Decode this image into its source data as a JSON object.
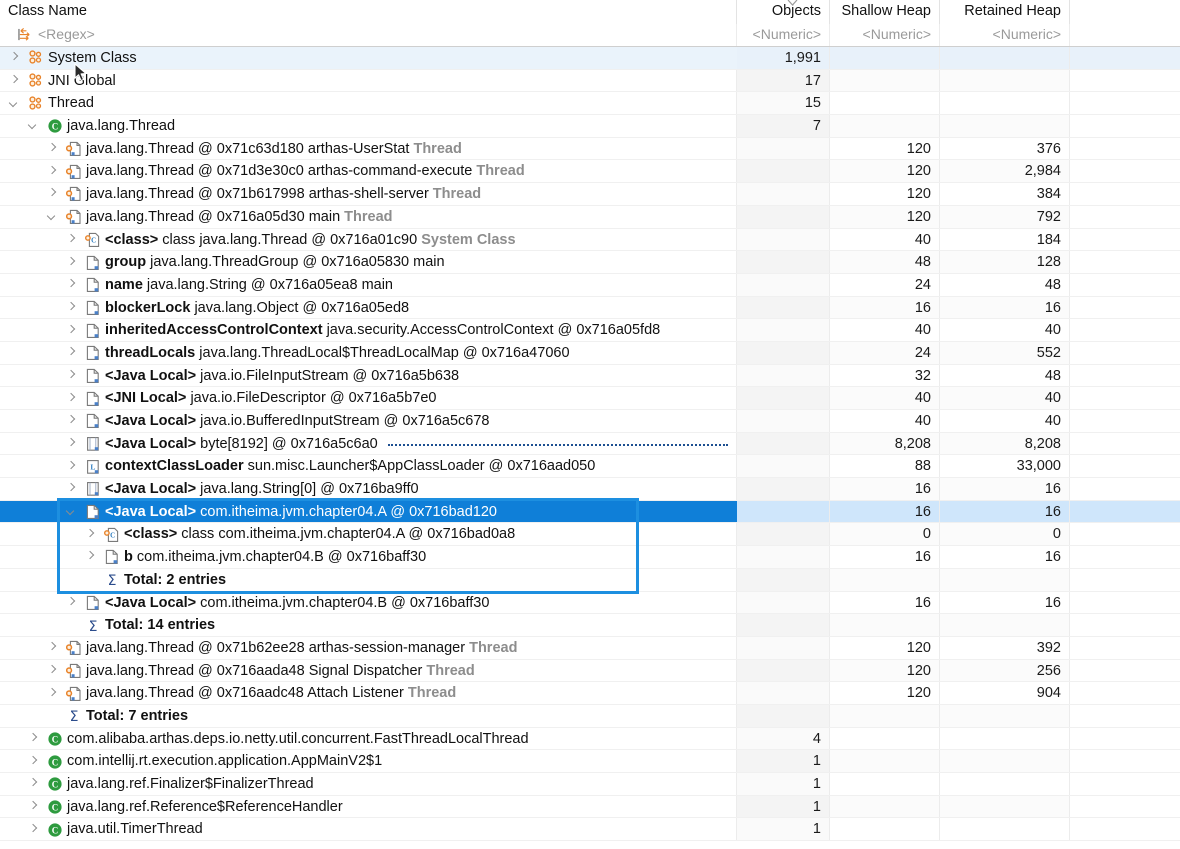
{
  "header": {
    "columns": [
      {
        "key": "name",
        "label": "Class Name",
        "filter": "<Regex>",
        "align": "left"
      },
      {
        "key": "objects",
        "label": "Objects",
        "filter": "<Numeric>",
        "align": "right"
      },
      {
        "key": "shallow",
        "label": "Shallow Heap",
        "filter": "<Numeric>",
        "align": "right"
      },
      {
        "key": "retained",
        "label": "Retained Heap",
        "filter": "<Numeric>",
        "align": "right"
      }
    ],
    "sorted_column": "Objects"
  },
  "colors": {
    "selection_bg": "#0f7fd8",
    "selection_row_tint": "#cfe6fb",
    "annotation_box": "#1d8fe0",
    "hover_row": "#eaf3fb",
    "class_icon": "#2e9b3f",
    "gcroot_icon": "#e8832a",
    "dim_text": "#8d8d8d"
  },
  "annotation": {
    "type": "rectangle-highlight",
    "around": "java-local-A-subtree"
  },
  "rows": [
    {
      "id": "system-class",
      "indent": 0,
      "arrow": "right",
      "icon": "gcroot-group",
      "name": "System Class",
      "objects": "1,991",
      "shallow": "",
      "retained": "",
      "state": "hover"
    },
    {
      "id": "jni-global",
      "indent": 0,
      "arrow": "right",
      "icon": "gcroot-group",
      "name": "JNI Global",
      "objects": "17",
      "shallow": "",
      "retained": ""
    },
    {
      "id": "thread-group",
      "indent": 0,
      "arrow": "down",
      "icon": "gcroot-group",
      "name": "Thread",
      "objects": "15",
      "shallow": "",
      "retained": ""
    },
    {
      "id": "java-lang-thread-class",
      "indent": 1,
      "arrow": "down",
      "icon": "class",
      "name": "java.lang.Thread",
      "objects": "7",
      "shallow": "",
      "retained": ""
    },
    {
      "id": "t-userstat",
      "indent": 2,
      "arrow": "right",
      "icon": "instance-gcroot",
      "prefix": "",
      "name": "java.lang.Thread @ 0x71c63d180  arthas-UserStat",
      "suffix": "Thread",
      "objects": "",
      "shallow": "120",
      "retained": "376"
    },
    {
      "id": "t-command-execute",
      "indent": 2,
      "arrow": "right",
      "icon": "instance-gcroot",
      "name": "java.lang.Thread @ 0x71d3e30c0  arthas-command-execute",
      "suffix": "Thread",
      "objects": "",
      "shallow": "120",
      "retained": "2,984"
    },
    {
      "id": "t-shell-server",
      "indent": 2,
      "arrow": "right",
      "icon": "instance-gcroot",
      "name": "java.lang.Thread @ 0x71b617998  arthas-shell-server",
      "suffix": "Thread",
      "objects": "",
      "shallow": "120",
      "retained": "384"
    },
    {
      "id": "t-main",
      "indent": 2,
      "arrow": "down",
      "icon": "instance-gcroot",
      "name": "java.lang.Thread @ 0x716a05d30  main",
      "suffix": "Thread",
      "objects": "",
      "shallow": "120",
      "retained": "792"
    },
    {
      "id": "f-class",
      "indent": 3,
      "arrow": "right",
      "icon": "class-field",
      "bold": "<class>",
      "name": "class java.lang.Thread @ 0x716a01c90",
      "suffix": "System Class",
      "objects": "",
      "shallow": "40",
      "retained": "184"
    },
    {
      "id": "f-group",
      "indent": 3,
      "arrow": "right",
      "icon": "field",
      "bold": "group",
      "name": "java.lang.ThreadGroup @ 0x716a05830  main",
      "objects": "",
      "shallow": "48",
      "retained": "128"
    },
    {
      "id": "f-name",
      "indent": 3,
      "arrow": "right",
      "icon": "field",
      "bold": "name",
      "name": "java.lang.String @ 0x716a05ea8  main",
      "objects": "",
      "shallow": "24",
      "retained": "48"
    },
    {
      "id": "f-blockerlock",
      "indent": 3,
      "arrow": "right",
      "icon": "field",
      "bold": "blockerLock",
      "name": "java.lang.Object @ 0x716a05ed8",
      "objects": "",
      "shallow": "16",
      "retained": "16"
    },
    {
      "id": "f-inherited-acc",
      "indent": 3,
      "arrow": "right",
      "icon": "field",
      "bold": "inheritedAccessControlContext",
      "name": "java.security.AccessControlContext @ 0x716a05fd8",
      "objects": "",
      "shallow": "40",
      "retained": "40"
    },
    {
      "id": "f-threadlocals",
      "indent": 3,
      "arrow": "right",
      "icon": "field",
      "bold": "threadLocals",
      "name": "java.lang.ThreadLocal$ThreadLocalMap @ 0x716a47060",
      "objects": "",
      "shallow": "24",
      "retained": "552"
    },
    {
      "id": "f-jl-fileinputstream",
      "indent": 3,
      "arrow": "right",
      "icon": "field",
      "bold": "<Java Local>",
      "name": "java.io.FileInputStream @ 0x716a5b638",
      "objects": "",
      "shallow": "32",
      "retained": "48"
    },
    {
      "id": "f-jni-filedescriptor",
      "indent": 3,
      "arrow": "right",
      "icon": "field",
      "bold": "<JNI Local>",
      "name": "java.io.FileDescriptor @ 0x716a5b7e0",
      "objects": "",
      "shallow": "40",
      "retained": "40"
    },
    {
      "id": "f-jl-bufferedinputstream",
      "indent": 3,
      "arrow": "right",
      "icon": "field",
      "bold": "<Java Local>",
      "name": "java.io.BufferedInputStream @ 0x716a5c678",
      "objects": "",
      "shallow": "40",
      "retained": "40"
    },
    {
      "id": "f-jl-byte8192",
      "indent": 3,
      "arrow": "right",
      "icon": "array",
      "bold": "<Java Local>",
      "name": "byte[8192] @ 0x716a5c6a0",
      "dots": true,
      "objects": "",
      "shallow": "8,208",
      "retained": "8,208"
    },
    {
      "id": "f-contextclassloader",
      "indent": 3,
      "arrow": "right",
      "icon": "classloader",
      "bold": "contextClassLoader",
      "name": "sun.misc.Launcher$AppClassLoader @ 0x716aad050",
      "objects": "",
      "shallow": "88",
      "retained": "33,000"
    },
    {
      "id": "f-jl-string0",
      "indent": 3,
      "arrow": "right",
      "icon": "array",
      "bold": "<Java Local>",
      "name": "java.lang.String[0] @ 0x716ba9ff0",
      "objects": "",
      "shallow": "16",
      "retained": "16"
    },
    {
      "id": "f-jl-A",
      "indent": 3,
      "arrow": "down",
      "icon": "field",
      "bold": "<Java Local>",
      "name": "com.itheima.jvm.chapter04.A @ 0x716bad120",
      "objects": "",
      "shallow": "16",
      "retained": "16",
      "state": "selected"
    },
    {
      "id": "f-A-class",
      "indent": 4,
      "arrow": "right",
      "icon": "class-field",
      "bold": "<class>",
      "name": "class com.itheima.jvm.chapter04.A @ 0x716bad0a8",
      "objects": "",
      "shallow": "0",
      "retained": "0"
    },
    {
      "id": "f-A-b",
      "indent": 4,
      "arrow": "right",
      "icon": "field",
      "bold": "b",
      "name": "com.itheima.jvm.chapter04.B @ 0x716baff30",
      "objects": "",
      "shallow": "16",
      "retained": "16"
    },
    {
      "id": "total-2",
      "indent": 4,
      "arrow": "none",
      "icon": "sum",
      "total": "Total: 2 entries",
      "objects": "",
      "shallow": "",
      "retained": ""
    },
    {
      "id": "f-jl-B",
      "indent": 3,
      "arrow": "right",
      "icon": "field",
      "bold": "<Java Local>",
      "name": "com.itheima.jvm.chapter04.B @ 0x716baff30",
      "objects": "",
      "shallow": "16",
      "retained": "16"
    },
    {
      "id": "total-14",
      "indent": 3,
      "arrow": "none",
      "icon": "sum",
      "total": "Total: 14 entries",
      "objects": "",
      "shallow": "",
      "retained": ""
    },
    {
      "id": "t-session-manager",
      "indent": 2,
      "arrow": "right",
      "icon": "instance-gcroot",
      "name": "java.lang.Thread @ 0x71b62ee28  arthas-session-manager",
      "suffix": "Thread",
      "objects": "",
      "shallow": "120",
      "retained": "392"
    },
    {
      "id": "t-signal-dispatcher",
      "indent": 2,
      "arrow": "right",
      "icon": "instance-gcroot",
      "name": "java.lang.Thread @ 0x716aada48  Signal Dispatcher",
      "suffix": "Thread",
      "objects": "",
      "shallow": "120",
      "retained": "256"
    },
    {
      "id": "t-attach-listener",
      "indent": 2,
      "arrow": "right",
      "icon": "instance-gcroot",
      "name": "java.lang.Thread @ 0x716aadc48  Attach Listener",
      "suffix": "Thread",
      "objects": "",
      "shallow": "120",
      "retained": "904"
    },
    {
      "id": "total-7",
      "indent": 2,
      "arrow": "none",
      "icon": "sum",
      "total": "Total: 7 entries",
      "objects": "",
      "shallow": "",
      "retained": ""
    },
    {
      "id": "c-fastthreadlocalthread",
      "indent": 1,
      "arrow": "right",
      "icon": "class",
      "name": "com.alibaba.arthas.deps.io.netty.util.concurrent.FastThreadLocalThread",
      "objects": "4",
      "shallow": "",
      "retained": ""
    },
    {
      "id": "c-appmainv2",
      "indent": 1,
      "arrow": "right",
      "icon": "class",
      "name": "com.intellij.rt.execution.application.AppMainV2$1",
      "objects": "1",
      "shallow": "",
      "retained": ""
    },
    {
      "id": "c-finalizerthread",
      "indent": 1,
      "arrow": "right",
      "icon": "class",
      "name": "java.lang.ref.Finalizer$FinalizerThread",
      "objects": "1",
      "shallow": "",
      "retained": ""
    },
    {
      "id": "c-referencehandler",
      "indent": 1,
      "arrow": "right",
      "icon": "class",
      "name": "java.lang.ref.Reference$ReferenceHandler",
      "objects": "1",
      "shallow": "",
      "retained": ""
    },
    {
      "id": "c-timerthread",
      "indent": 1,
      "arrow": "right",
      "icon": "class",
      "name": "java.util.TimerThread",
      "objects": "1",
      "shallow": "",
      "retained": ""
    }
  ]
}
